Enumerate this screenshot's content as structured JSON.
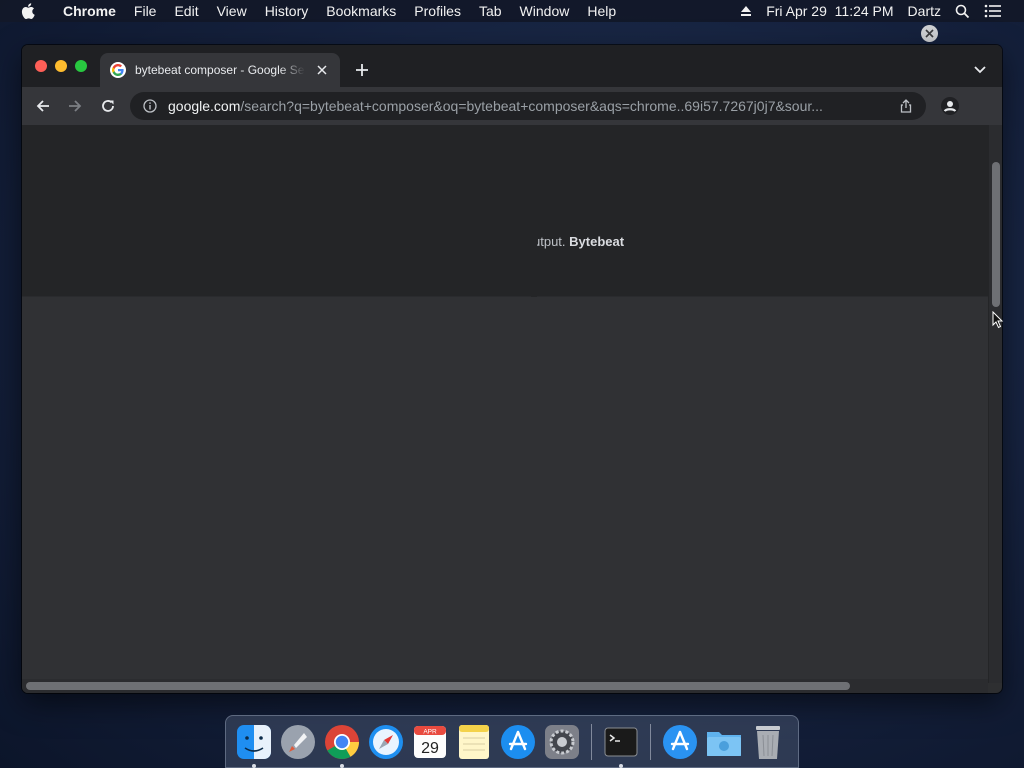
{
  "menubar": {
    "app_name": "Chrome",
    "items": [
      "File",
      "Edit",
      "View",
      "History",
      "Bookmarks",
      "Profiles",
      "Tab",
      "Window",
      "Help"
    ],
    "datetime": "Fri Apr 29  11:24 PM",
    "user": "Dartz"
  },
  "browser": {
    "tab": {
      "title": "bytebeat composer - Google Search"
    },
    "url": {
      "domain": "google.com",
      "path": "/search?q=bytebeat+composer&oq=bytebeat+composer&aqs=chrome..69i57.7267j0j7&sour..."
    }
  },
  "page": {
    "snippet_prefix": "utput. ",
    "snippet_bold": "Bytebeat"
  },
  "dock": {
    "calendar_month": "APR",
    "calendar_day": "29",
    "items": [
      "finder-icon",
      "launchpad-icon",
      "chrome-icon",
      "safari-icon",
      "calendar-icon",
      "notes-icon",
      "app-store-icon",
      "system-preferences-icon",
      "terminal-icon",
      "applications-folder-icon",
      "downloads-folder-icon",
      "trash-icon"
    ]
  },
  "colors": {
    "accent_blue": "#8ab4f8",
    "traffic_red": "#fe5f57",
    "traffic_yellow": "#febc2e",
    "traffic_green": "#28c840"
  }
}
